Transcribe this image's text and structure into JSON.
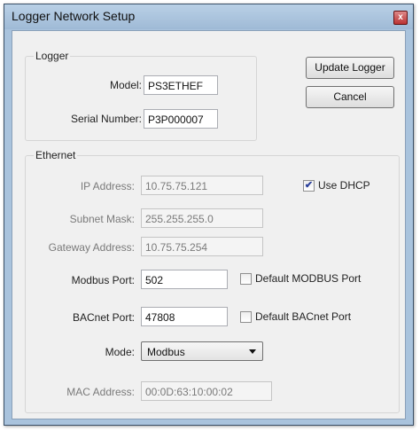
{
  "window": {
    "title": "Logger Network Setup",
    "close_glyph": "x"
  },
  "logger_group": {
    "label": "Logger",
    "model_label": "Model:",
    "model_value": "PS3ETHEF",
    "serial_label": "Serial Number:",
    "serial_value": "P3P000007"
  },
  "buttons": {
    "update": "Update Logger",
    "cancel": "Cancel"
  },
  "ethernet_group": {
    "label": "Ethernet",
    "ip_label": "IP Address:",
    "ip_value": "10.75.75.121",
    "use_dhcp_label": "Use DHCP",
    "use_dhcp_checked": true,
    "subnet_label": "Subnet Mask:",
    "subnet_value": "255.255.255.0",
    "gateway_label": "Gateway Address:",
    "gateway_value": "10.75.75.254",
    "modbus_label": "Modbus Port:",
    "modbus_value": "502",
    "default_modbus_label": "Default MODBUS Port",
    "bacnet_label": "BACnet Port:",
    "bacnet_value": "47808",
    "default_bacnet_label": "Default BACnet Port",
    "mode_label": "Mode:",
    "mode_value": "Modbus",
    "mac_label": "MAC Address:",
    "mac_value": "00:0D:63:10:00:02"
  },
  "colors": {
    "window_frame": "#a9c3dd",
    "client_bg": "#f0f0f0",
    "check_mark": "#2a3f9a"
  },
  "icons": {
    "check": "✔"
  }
}
